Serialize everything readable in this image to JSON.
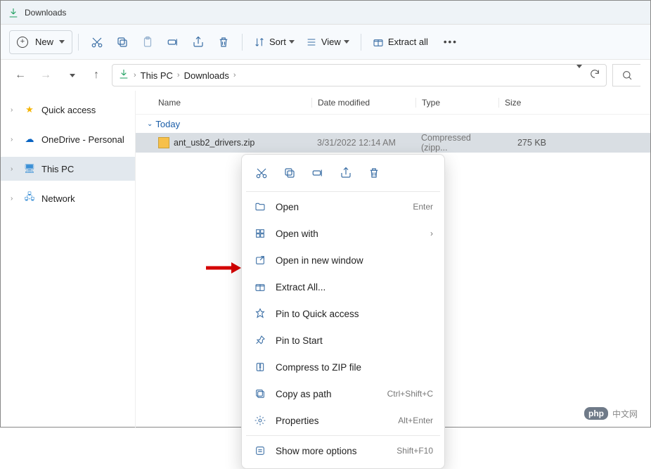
{
  "window": {
    "title": "Downloads"
  },
  "toolbar": {
    "new_label": "New",
    "sort_label": "Sort",
    "view_label": "View",
    "extract_all_label": "Extract all"
  },
  "breadcrumb": {
    "root": "This PC",
    "folder": "Downloads"
  },
  "sidebar": {
    "items": [
      {
        "label": "Quick access"
      },
      {
        "label": "OneDrive - Personal"
      },
      {
        "label": "This PC"
      },
      {
        "label": "Network"
      }
    ]
  },
  "columns": {
    "name": "Name",
    "date": "Date modified",
    "type": "Type",
    "size": "Size"
  },
  "group": {
    "label": "Today"
  },
  "files": [
    {
      "name": "ant_usb2_drivers.zip",
      "date": "3/31/2022 12:14 AM",
      "type": "Compressed (zipp...",
      "size": "275 KB"
    }
  ],
  "context_menu": {
    "items": [
      {
        "label": "Open",
        "accel": "Enter"
      },
      {
        "label": "Open with",
        "accel": "›"
      },
      {
        "label": "Open in new window",
        "accel": ""
      },
      {
        "label": "Extract All...",
        "accel": ""
      },
      {
        "label": "Pin to Quick access",
        "accel": ""
      },
      {
        "label": "Pin to Start",
        "accel": ""
      },
      {
        "label": "Compress to ZIP file",
        "accel": ""
      },
      {
        "label": "Copy as path",
        "accel": "Ctrl+Shift+C"
      },
      {
        "label": "Properties",
        "accel": "Alt+Enter"
      },
      {
        "label": "Show more options",
        "accel": "Shift+F10"
      }
    ]
  },
  "watermark": {
    "text": "中文网"
  }
}
